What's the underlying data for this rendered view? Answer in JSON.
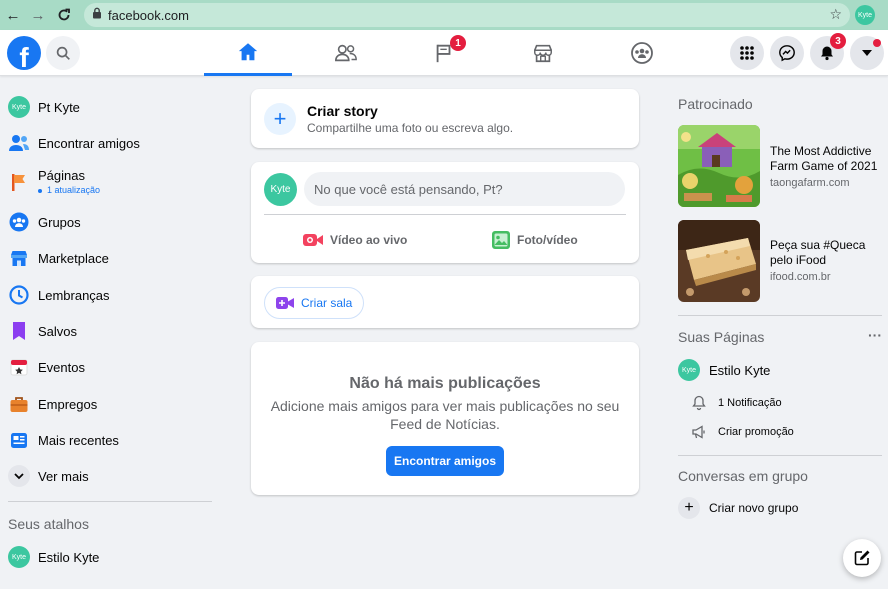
{
  "browser": {
    "url": "facebook.com",
    "profile_initials": "Kyte"
  },
  "header": {
    "logo": "f",
    "tabs": [
      {
        "name": "home",
        "active": true
      },
      {
        "name": "friends",
        "active": false
      },
      {
        "name": "pages",
        "active": false,
        "badge": "1"
      },
      {
        "name": "marketplace",
        "active": false
      },
      {
        "name": "groups",
        "active": false
      }
    ],
    "notifications_badge": "3"
  },
  "sidebar": {
    "items": [
      {
        "label": "Pt Kyte",
        "icon": "profile-avatar"
      },
      {
        "label": "Encontrar amigos",
        "icon": "friends-icon"
      },
      {
        "label": "Páginas",
        "sub": "1 atualização",
        "icon": "flag-icon"
      },
      {
        "label": "Grupos",
        "icon": "groups-icon"
      },
      {
        "label": "Marketplace",
        "icon": "shop-icon"
      },
      {
        "label": "Lembranças",
        "icon": "clock-icon"
      },
      {
        "label": "Salvos",
        "icon": "bookmark-icon"
      },
      {
        "label": "Eventos",
        "icon": "calendar-icon"
      },
      {
        "label": "Empregos",
        "icon": "briefcase-icon"
      },
      {
        "label": "Mais recentes",
        "icon": "feed-icon"
      },
      {
        "label": "Ver mais",
        "icon": "chevron-down-icon"
      }
    ],
    "shortcuts_title": "Seus atalhos",
    "shortcut": "Estilo Kyte",
    "avatar_initials": "Kyte"
  },
  "feed": {
    "story_title": "Criar story",
    "story_sub": "Compartilhe uma foto ou escreva algo.",
    "composer_placeholder": "No que você está pensando, Pt?",
    "live_label": "Vídeo ao vivo",
    "photo_label": "Foto/vídeo",
    "room_label": "Criar sala",
    "empty_title": "Não há mais publicações",
    "empty_sub": "Adicione mais amigos para ver mais publicações no seu Feed de Notícias.",
    "find_friends_button": "Encontrar amigos"
  },
  "right": {
    "sponsored_title": "Patrocinado",
    "ads": [
      {
        "title": "The Most Addictive Farm Game of 2021",
        "url": "taongafarm.com"
      },
      {
        "title": "Peça sua #Queca pelo iFood",
        "url": "ifood.com.br"
      }
    ],
    "your_pages_title": "Suas Páginas",
    "more": "···",
    "page_name": "Estilo Kyte",
    "notification": "1 Notificação",
    "promotion": "Criar promoção",
    "group_convos_title": "Conversas em grupo",
    "new_group": "Criar novo grupo"
  },
  "colors": {
    "brand": "#1877f2",
    "badge": "#e41e3f",
    "avatar": "#3cc7a0"
  }
}
